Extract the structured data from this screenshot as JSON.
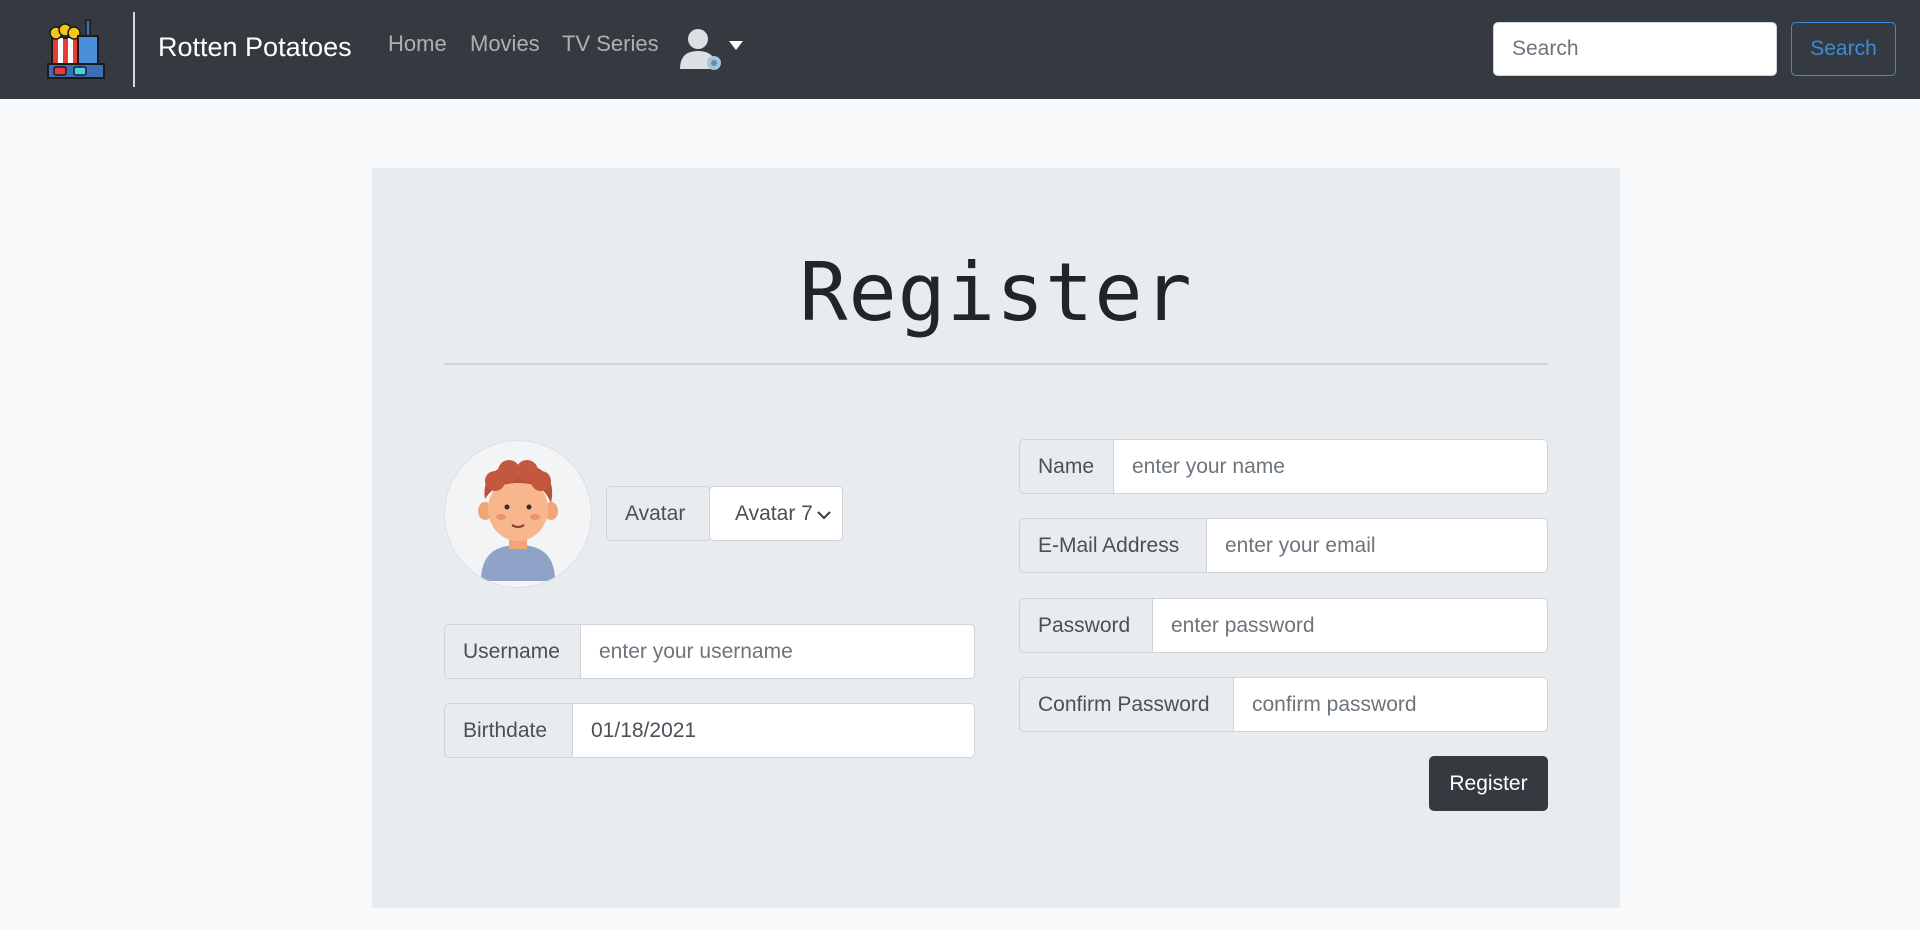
{
  "navbar": {
    "brand": "Rotten Potatoes",
    "links": [
      {
        "label": "Home"
      },
      {
        "label": "Movies"
      },
      {
        "label": "TV Series"
      }
    ],
    "user_icon": "user-gear-icon",
    "search_placeholder": "Search",
    "search_button": "Search"
  },
  "register": {
    "title": "Register",
    "avatar_label": "Avatar",
    "avatar_value": "Avatar 7",
    "username_label": "Username",
    "username_placeholder": "enter your username",
    "birthdate_label": "Birthdate",
    "birthdate_value": "01/18/2021",
    "name_label": "Name",
    "name_placeholder": "enter your name",
    "email_label": "E-Mail Address",
    "email_placeholder": "enter your email",
    "password_label": "Password",
    "password_placeholder": "enter password",
    "confirm_label": "Confirm Password",
    "confirm_placeholder": "confirm password",
    "submit": "Register"
  },
  "colors": {
    "navbar_bg": "#343a40",
    "page_bg": "#f8f9fa",
    "card_bg": "#e9ecef",
    "accent": "#3d8bd9"
  }
}
